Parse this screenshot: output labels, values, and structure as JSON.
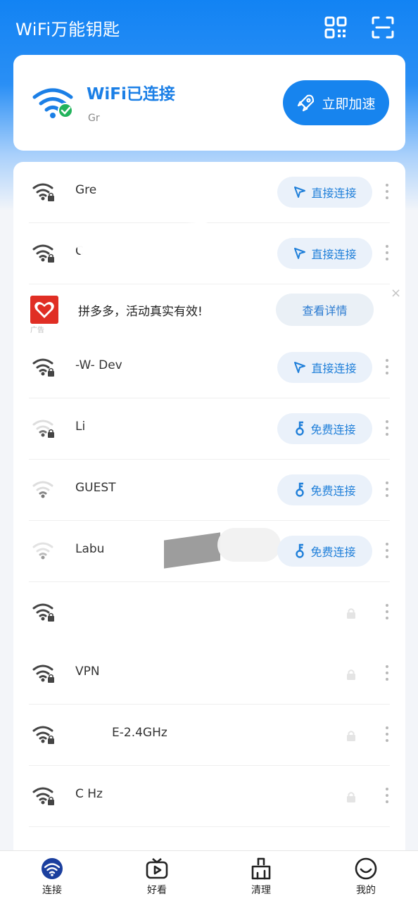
{
  "header": {
    "title": "WiFi万能钥匙",
    "icons": [
      "qr-code-icon",
      "scan-icon"
    ]
  },
  "status_card": {
    "title": "WiFi已连接",
    "network": "Gr",
    "speed_button": "立即加速",
    "icons": [
      "wifi-connected-icon",
      "rocket-icon"
    ]
  },
  "networks": [
    {
      "ssid": "Gre",
      "action": "直接连接",
      "action_icon": "tap-icon",
      "signal": "strong",
      "locked": true
    },
    {
      "ssid": "C",
      "action": "直接连接",
      "action_icon": "tap-icon",
      "signal": "strong",
      "locked": true
    },
    {
      "ssid": "-W- Dev",
      "action": "直接连接",
      "action_icon": "tap-icon",
      "signal": "strong",
      "locked": true
    },
    {
      "ssid": "Li",
      "action": "免费连接",
      "action_icon": "key-icon",
      "signal": "weak",
      "locked": true
    },
    {
      "ssid": "GUEST",
      "action": "免费连接",
      "action_icon": "key-icon",
      "signal": "weak",
      "locked": false
    },
    {
      "ssid": "Labu",
      "action": "免费连接",
      "action_icon": "key-icon",
      "signal": "weak",
      "locked": false
    },
    {
      "ssid": "",
      "action": "",
      "signal": "strong",
      "locked": true
    },
    {
      "ssid": "VPN",
      "action": "",
      "signal": "strong",
      "locked": true
    },
    {
      "ssid": "E-2.4GHz",
      "action": "",
      "signal": "strong",
      "locked": true
    },
    {
      "ssid": "C Hz",
      "action": "",
      "signal": "strong",
      "locked": true
    }
  ],
  "ad": {
    "text": "拼多多，活动真实有效!",
    "button": "查看详情",
    "tag": "广告",
    "close": "×"
  },
  "bottom_nav": [
    {
      "label": "连接",
      "icon": "wifi-nav-icon",
      "active": true
    },
    {
      "label": "好看",
      "icon": "video-play-icon",
      "active": false
    },
    {
      "label": "清理",
      "icon": "broom-icon",
      "active": false
    },
    {
      "label": "我的",
      "icon": "smiley-icon",
      "active": false
    }
  ],
  "colors": {
    "brand_blue": "#1784ee",
    "accent_text": "#1f7fd9",
    "success_green": "#22b35c"
  }
}
